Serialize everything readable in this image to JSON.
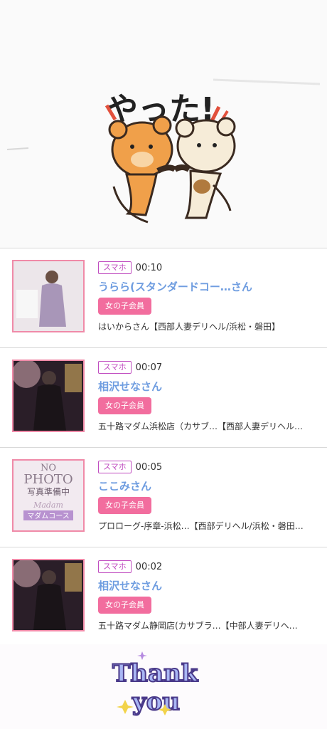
{
  "hero": {
    "sticker_text": "やった!"
  },
  "items": [
    {
      "device": "スマホ",
      "time": "00:10",
      "name": "うらら(スタンダードコー…さん",
      "badge": "女の子会員",
      "shop": "はいからさん【西部人妻デリヘル/浜松・磐田】",
      "photo": "photo"
    },
    {
      "device": "スマホ",
      "time": "00:07",
      "name": "相沢せなさん",
      "badge": "女の子会員",
      "shop": "五十路マダム浜松店（カサブ…【西部人妻デリヘル…",
      "photo": "photo"
    },
    {
      "device": "スマホ",
      "time": "00:05",
      "name": "ここみさん",
      "badge": "女の子会員",
      "shop": "プロローグ-序章-浜松…【西部デリヘル/浜松・磐田…",
      "photo": "no-photo",
      "no_photo": {
        "line1": "NO",
        "line2": "PHOTO",
        "line3": "写真準備中",
        "line4": "Madam",
        "line5": "マダムコース"
      }
    },
    {
      "device": "スマホ",
      "time": "00:02",
      "name": "相沢せなさん",
      "badge": "女の子会員",
      "shop": "五十路マダム静岡店(カサブラ…【中部人妻デリヘ…",
      "photo": "photo"
    }
  ],
  "footer": {
    "line1": "Thank",
    "line2": "you"
  },
  "colors": {
    "device_border": "#c04cc0",
    "name": "#6f9de0",
    "badge": "#f26d9e",
    "thumb_border": "#f08aa8"
  }
}
